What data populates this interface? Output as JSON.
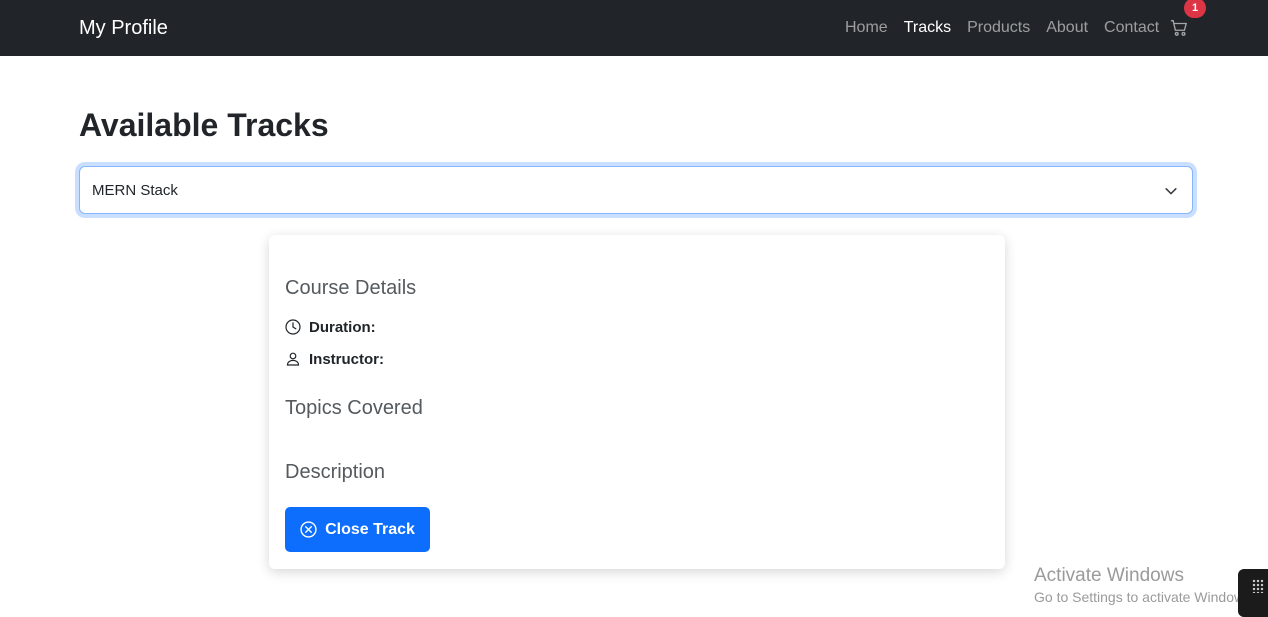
{
  "navbar": {
    "brand": "My Profile",
    "links": [
      "Home",
      "Tracks",
      "Products",
      "About",
      "Contact"
    ],
    "active_link": "Tracks",
    "cart_icon": "cart-icon",
    "cart_count": "1"
  },
  "main": {
    "title": "Available Tracks",
    "select": {
      "value": "MERN Stack",
      "icon": "chevron-down-icon"
    }
  },
  "card": {
    "course_details_heading": "Course Details",
    "duration_label": "Duration:",
    "duration_icon": "clock-icon",
    "instructor_label": "Instructor:",
    "instructor_icon": "person-icon",
    "topics_heading": "Topics Covered",
    "description_heading": "Description",
    "close_button": "Close Track",
    "close_icon": "x-circle-icon"
  },
  "watermark": {
    "title": "Activate Windows",
    "subtitle": "Go to Settings to activate Windows."
  },
  "colors": {
    "navbar_bg": "#212529",
    "primary": "#0d6efd",
    "badge": "#dc3545"
  }
}
